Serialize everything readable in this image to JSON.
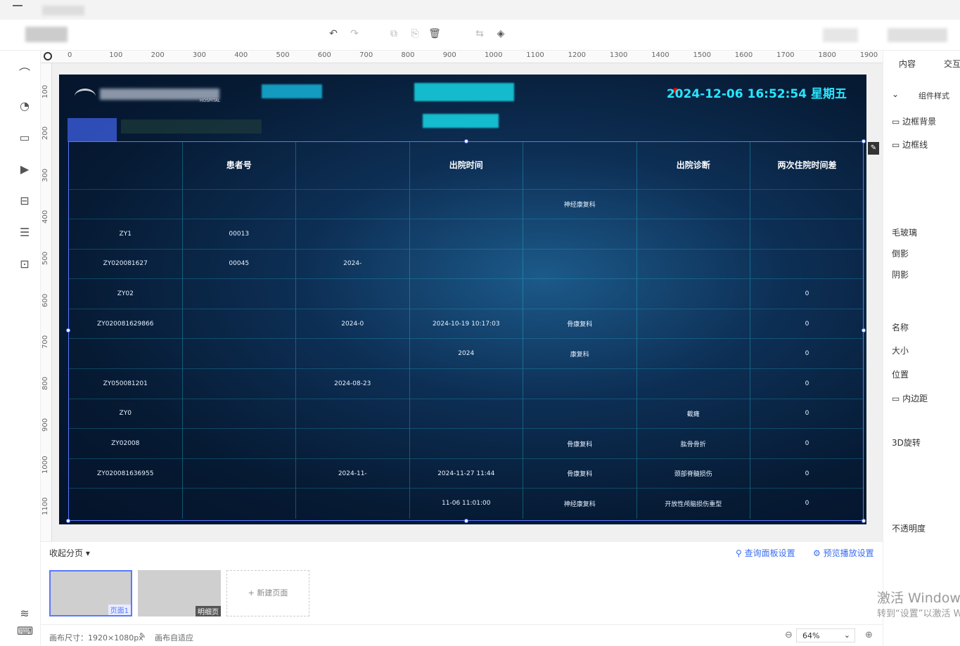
{
  "toolbar": {
    "undo_icon": "undo-icon",
    "redo_icon": "redo-icon",
    "delete_icon": "trash-icon"
  },
  "ruler": {
    "top_ticks": [
      "0",
      "100",
      "200",
      "300",
      "400",
      "500",
      "600",
      "700",
      "800",
      "900",
      "1000",
      "1100",
      "1200",
      "1300",
      "1400",
      "1500",
      "1600",
      "1700",
      "1800",
      "1900"
    ],
    "left_ticks": [
      "100",
      "200",
      "300",
      "400",
      "500",
      "600",
      "700",
      "800",
      "900",
      "1000",
      "1100"
    ]
  },
  "screen": {
    "datetime": "2024-12-06  16:52:54  星期五",
    "logo_subtitle": "HOSPITAL"
  },
  "table": {
    "headers": [
      "",
      "患者号",
      "",
      "出院时间",
      "",
      "出院诊断",
      "两次住院时间差"
    ],
    "rows": [
      [
        "",
        "",
        "",
        "",
        "神经康复科",
        "",
        ""
      ],
      [
        "ZY1",
        "00013",
        "",
        "",
        "",
        "",
        ""
      ],
      [
        "ZY020081627",
        "00045",
        "2024-",
        "",
        "",
        "",
        ""
      ],
      [
        "ZY02",
        "",
        "",
        "",
        "",
        "",
        "0"
      ],
      [
        "ZY020081629866",
        "",
        "2024-0",
        "2024-10-19 10:17:03",
        "骨康复科",
        "",
        "0"
      ],
      [
        "",
        "",
        "",
        "2024",
        "康复科",
        "",
        "0"
      ],
      [
        "ZY050081201",
        "",
        "2024-08-23",
        "",
        "",
        "",
        "0"
      ],
      [
        "ZY0",
        "",
        "",
        "",
        "",
        "截瘫",
        "0"
      ],
      [
        "ZY02008",
        "",
        "",
        "",
        "骨康复科",
        "肱骨骨折",
        "0"
      ],
      [
        "ZY020081636955",
        "",
        "2024-11-",
        "2024-11-27 11:44",
        "骨康复科",
        "颈部脊髓损伤",
        "0"
      ],
      [
        "",
        "",
        "",
        "11-06 11:01:00",
        "神经康复科",
        "开放性颅脑损伤重型",
        "0"
      ]
    ]
  },
  "right_panel": {
    "tabs": [
      "内容",
      "交互"
    ],
    "section": "组件样式",
    "items": [
      "边框背景",
      "边框线",
      "毛玻璃",
      "倒影",
      "阴影",
      "名称",
      "大小",
      "位置",
      "内边距",
      "3D旋转",
      "不透明度"
    ]
  },
  "bottom": {
    "collapse_label": "收起分页",
    "query_panel": "查询面板设置",
    "preview_settings": "预览播放设置",
    "page1_label": "页面1",
    "page2_label": "明细页",
    "new_page": "+ 新建页面"
  },
  "status": {
    "canvas_size": "画布尺寸：1920×1080px",
    "canvas_adapt": "画布自适应",
    "zoom": "64%"
  },
  "watermark": {
    "line1": "激活 Windows",
    "line2": "转到“设置”以激活 Windows。"
  }
}
